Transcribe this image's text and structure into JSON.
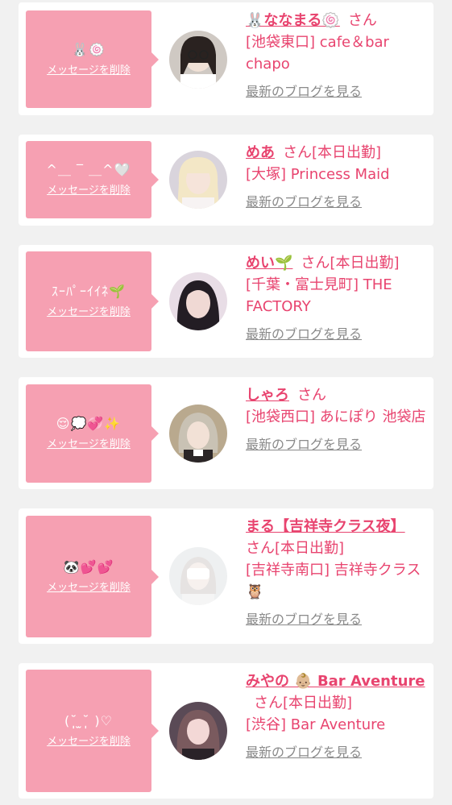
{
  "cards": [
    {
      "message": "🐰🍥",
      "delete_label": "メッセージを削除",
      "name": "🐰ななまる🍥",
      "san": "さん",
      "shop": "[池袋東口] cafe＆bar chapo",
      "blog_label": "最新のブログを見る"
    },
    {
      "message": "^＿ ‾ ＿^🤍",
      "delete_label": "メッセージを削除",
      "name": "めあ",
      "san": "さん[本日出勤]",
      "shop": "[大塚] Princess Maid",
      "blog_label": "最新のブログを見る"
    },
    {
      "message": "ｽｰﾊﾟｰｲｲﾈ🌱",
      "delete_label": "メッセージを削除",
      "name": "めい🌱",
      "san": "さん[本日出勤]",
      "shop": "[千葉・富士見町] THE FACTORY",
      "blog_label": "最新のブログを見る"
    },
    {
      "message": "😌💭💞✨",
      "delete_label": "メッセージを削除",
      "name": "しゃろ",
      "san": "さん",
      "shop": "[池袋西口] あにぽり 池袋店",
      "blog_label": "最新のブログを見る"
    },
    {
      "message": "🐼💕💕",
      "delete_label": "メッセージを削除",
      "name": "まる【吉祥寺クラス夜】",
      "san": "さん[本日出勤]",
      "shop": "[吉祥寺南口] 吉祥寺クラス🦉",
      "blog_label": "最新のブログを見る"
    },
    {
      "message": "(˘̩̩̩ ̫˘̩̩̩ )♡",
      "delete_label": "メッセージを削除",
      "name": "みやの 👶🏼 Bar Aventure",
      "san": "さん[本日出勤]",
      "shop": "[渋谷] Bar Aventure",
      "blog_label": "最新のブログを見る"
    }
  ],
  "colors": {
    "accent": "#e8446f",
    "bubble": "#f6a0b2",
    "background": "#f1f1f1",
    "link_gray": "#8a8a8a"
  }
}
